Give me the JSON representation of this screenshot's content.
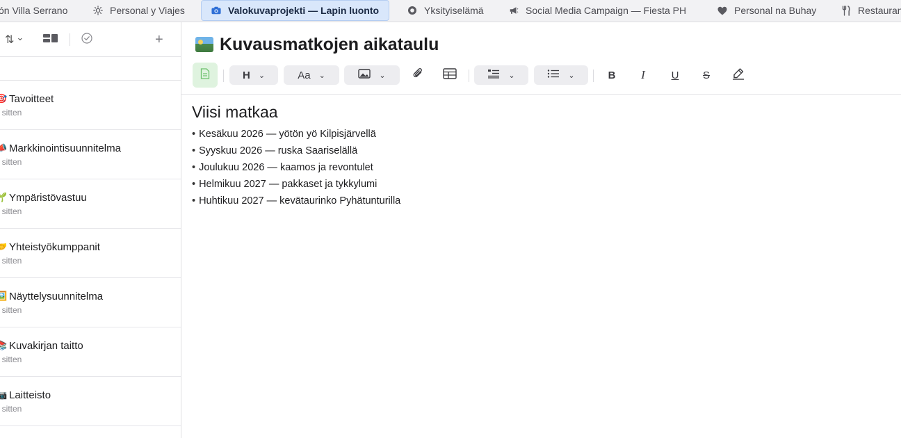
{
  "tabs": [
    {
      "label": "ón Villa Serrano",
      "icon": "none",
      "active": false
    },
    {
      "label": "Personal y Viajes",
      "icon": "sun-icon",
      "active": false
    },
    {
      "label": "Valokuvaprojekti — Lapin luonto",
      "icon": "camera-icon",
      "active": true
    },
    {
      "label": "Yksityiselämä",
      "icon": "circle-icon",
      "active": false
    },
    {
      "label": "Social Media Campaign — Fiesta PH",
      "icon": "megaphone-icon",
      "active": false
    },
    {
      "label": "Personal na Buhay",
      "icon": "heart-icon",
      "active": false
    },
    {
      "label": "Restauran",
      "icon": "fork-knife-icon",
      "active": false
    }
  ],
  "sidebar": {
    "toolbar": {
      "sort_icon": "⇅",
      "sort_chevron": "⌄",
      "view_icon": "▦",
      "check_icon": "✓",
      "add_icon": "+"
    },
    "notes": [
      {
        "emoji": "🎯",
        "title": "Tavoitteet",
        "time": "t sitten"
      },
      {
        "emoji": "📣",
        "title": "Markkinointisuunnitelma",
        "time": "t sitten"
      },
      {
        "emoji": "🌱",
        "title": "Ympäristövastuu",
        "time": "t sitten"
      },
      {
        "emoji": "🤝",
        "title": "Yhteistyökumppanit",
        "time": "t sitten"
      },
      {
        "emoji": "🖼️",
        "title": "Näyttelysuunnitelma",
        "time": "t sitten"
      },
      {
        "emoji": "📚",
        "title": "Kuvakirjan taitto",
        "time": "t sitten"
      },
      {
        "emoji": "📷",
        "title": "Laitteisto",
        "time": "t sitten"
      }
    ]
  },
  "editor": {
    "title": "Kuvausmatkojen aikataulu",
    "toolbar": {
      "heading_label": "H",
      "font_label": "Aa",
      "bold_label": "B",
      "italic_label": "I",
      "underline_label": "U",
      "strike_label": "S"
    },
    "heading": "Viisi matkaa",
    "items": [
      "Kesäkuu 2026 — yötön yö Kilpisjärvellä",
      "Syyskuu 2026 — ruska Saariselällä",
      "Joulukuu 2026 — kaamos ja revontulet",
      "Helmikuu 2027 — pakkaset ja tykkylumi",
      "Huhtikuu 2027 — kevätaurinko Pyhätunturilla"
    ]
  },
  "colors": {
    "active_tab_bg": "#d9e7fb",
    "accent": "#2f6fd6",
    "doc_button_bg": "#dff3df"
  }
}
